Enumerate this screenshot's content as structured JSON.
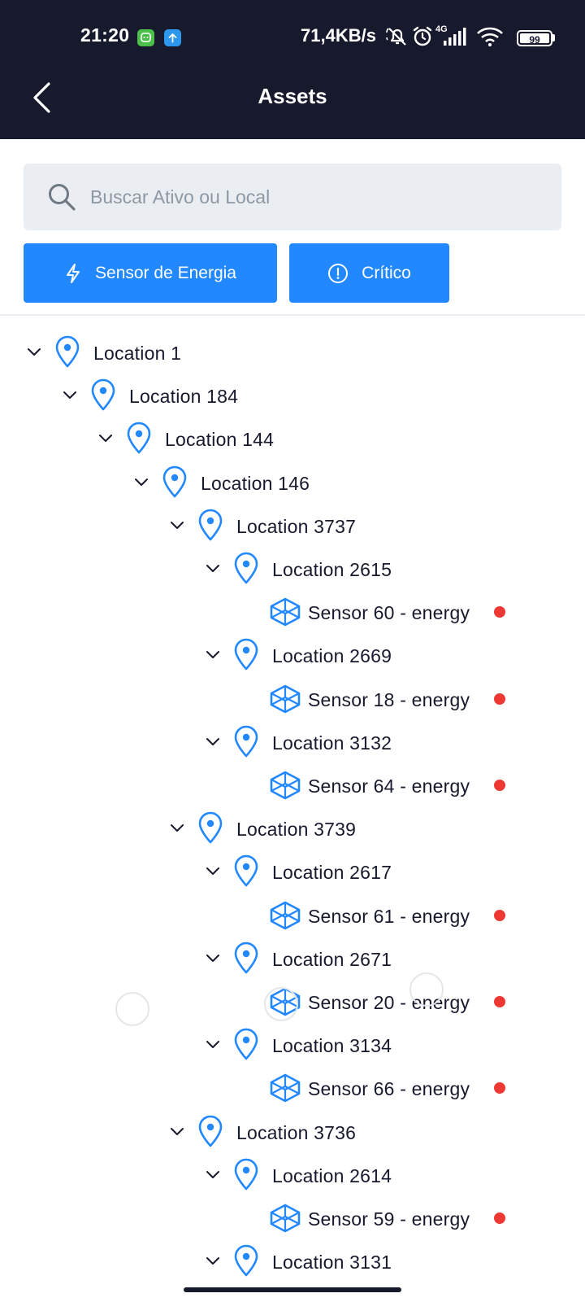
{
  "status_bar": {
    "time": "21:20",
    "network_speed": "71,4KB/s",
    "network_type": "4G",
    "battery": "99",
    "icons": [
      "chat-app-icon",
      "upload-icon",
      "mute-icon",
      "alarm-icon",
      "signal-icon",
      "wifi-icon",
      "battery-icon"
    ]
  },
  "header": {
    "title": "Assets",
    "back_icon": "chevron-left-icon",
    "background": "#17192d"
  },
  "search": {
    "placeholder": "Buscar Ativo ou Local",
    "value": ""
  },
  "filters": [
    {
      "label": "Sensor de Energia",
      "icon": "bolt-icon"
    },
    {
      "label": "Crítico",
      "icon": "alert-circle-icon"
    }
  ],
  "colors": {
    "accent": "#2188ff",
    "critical": "#ed3833",
    "text": "#17192d",
    "search_bg": "#eaeef2"
  },
  "tree": [
    {
      "label": "Location 1",
      "type": "location",
      "depth": 0,
      "expanded": true
    },
    {
      "label": "Location 184",
      "type": "location",
      "depth": 1,
      "expanded": true
    },
    {
      "label": "Location 144",
      "type": "location",
      "depth": 2,
      "expanded": true
    },
    {
      "label": "Location 146",
      "type": "location",
      "depth": 3,
      "expanded": true
    },
    {
      "label": "Location 3737",
      "type": "location",
      "depth": 4,
      "expanded": true
    },
    {
      "label": "Location 2615",
      "type": "location",
      "depth": 5,
      "expanded": true
    },
    {
      "label": "Sensor 60 - energy",
      "type": "component",
      "depth": 6,
      "status": "critical"
    },
    {
      "label": "Location 2669",
      "type": "location",
      "depth": 5,
      "expanded": true
    },
    {
      "label": "Sensor 18 - energy",
      "type": "component",
      "depth": 6,
      "status": "critical"
    },
    {
      "label": "Location 3132",
      "type": "location",
      "depth": 5,
      "expanded": true
    },
    {
      "label": "Sensor 64 - energy",
      "type": "component",
      "depth": 6,
      "status": "critical"
    },
    {
      "label": "Location 3739",
      "type": "location",
      "depth": 4,
      "expanded": true
    },
    {
      "label": "Location 2617",
      "type": "location",
      "depth": 5,
      "expanded": true
    },
    {
      "label": "Sensor 61 - energy",
      "type": "component",
      "depth": 6,
      "status": "critical"
    },
    {
      "label": "Location 2671",
      "type": "location",
      "depth": 5,
      "expanded": true
    },
    {
      "label": "Sensor 20 - energy",
      "type": "component",
      "depth": 6,
      "status": "critical"
    },
    {
      "label": "Location 3134",
      "type": "location",
      "depth": 5,
      "expanded": true
    },
    {
      "label": "Sensor 66 - energy",
      "type": "component",
      "depth": 6,
      "status": "critical"
    },
    {
      "label": "Location 3736",
      "type": "location",
      "depth": 4,
      "expanded": true
    },
    {
      "label": "Location 2614",
      "type": "location",
      "depth": 5,
      "expanded": true
    },
    {
      "label": "Sensor 59 - energy",
      "type": "component",
      "depth": 6,
      "status": "critical"
    },
    {
      "label": "Location 3131",
      "type": "location",
      "depth": 5,
      "expanded": true
    }
  ]
}
